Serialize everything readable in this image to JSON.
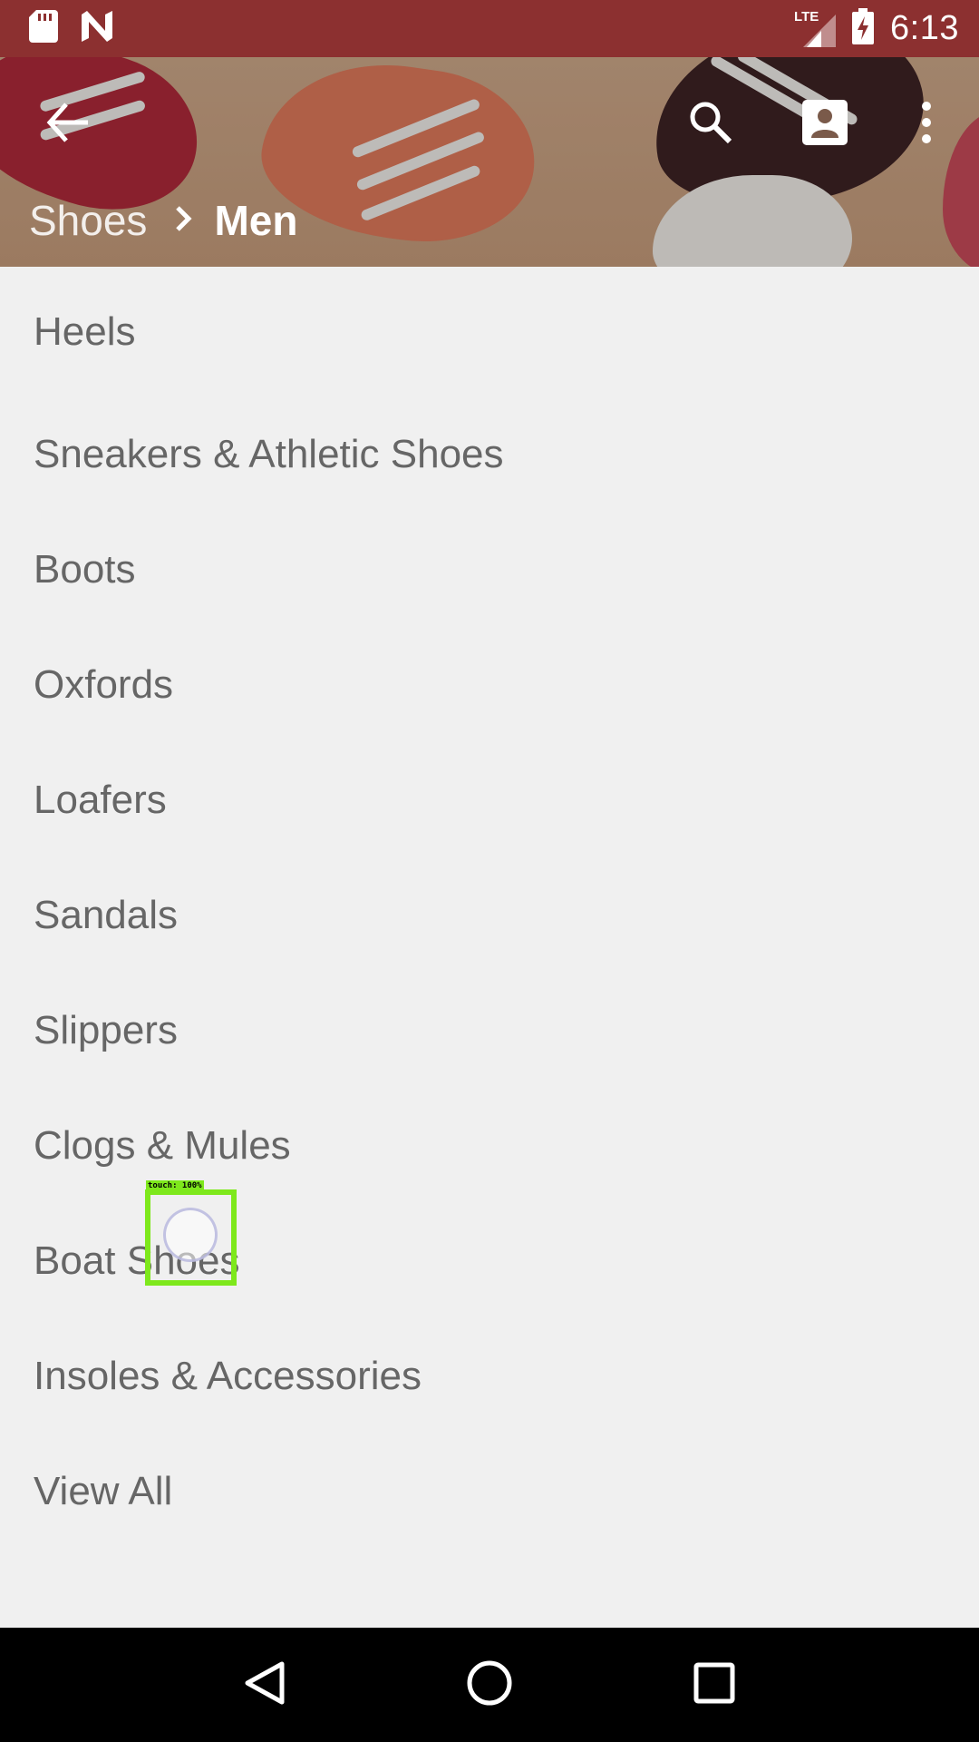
{
  "status_bar": {
    "time": "6:13",
    "network": "LTE"
  },
  "header": {
    "breadcrumb_parent": "Shoes",
    "breadcrumb_current": "Men"
  },
  "categories": [
    "Heels",
    "Sneakers & Athletic Shoes",
    "Boots",
    "Oxfords",
    "Loafers",
    "Sandals",
    "Slippers",
    "Clogs & Mules",
    "Boat Shoes",
    "Insoles & Accessories",
    "View All"
  ],
  "touch_indicator": {
    "label": "touch: 100%"
  },
  "colors": {
    "status_bar": "#8c3030",
    "list_text": "#666666",
    "background": "#f0f0f0",
    "touch_box": "#7ee81c"
  }
}
